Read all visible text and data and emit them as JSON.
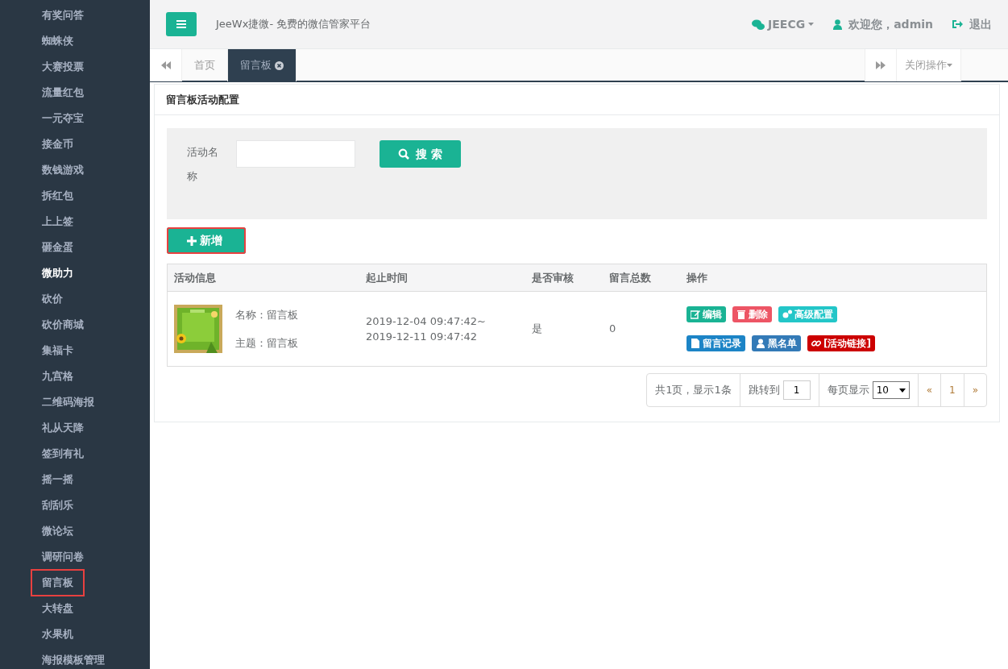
{
  "sidebar": {
    "items": [
      {
        "label": "有奖问答",
        "selected": false,
        "annotated": false
      },
      {
        "label": "蜘蛛侠",
        "selected": false,
        "annotated": false
      },
      {
        "label": "大赛投票",
        "selected": false,
        "annotated": false
      },
      {
        "label": "流量红包",
        "selected": false,
        "annotated": false
      },
      {
        "label": "一元夺宝",
        "selected": false,
        "annotated": false
      },
      {
        "label": "接金币",
        "selected": false,
        "annotated": false
      },
      {
        "label": "数钱游戏",
        "selected": false,
        "annotated": false
      },
      {
        "label": "拆红包",
        "selected": false,
        "annotated": false
      },
      {
        "label": "上上签",
        "selected": false,
        "annotated": false
      },
      {
        "label": "砸金蛋",
        "selected": false,
        "annotated": false
      },
      {
        "label": "微助力",
        "selected": true,
        "annotated": false
      },
      {
        "label": "砍价",
        "selected": false,
        "annotated": false
      },
      {
        "label": "砍价商城",
        "selected": false,
        "annotated": false
      },
      {
        "label": "集福卡",
        "selected": false,
        "annotated": false
      },
      {
        "label": "九宫格",
        "selected": false,
        "annotated": false
      },
      {
        "label": "二维码海报",
        "selected": false,
        "annotated": false
      },
      {
        "label": "礼从天降",
        "selected": false,
        "annotated": false
      },
      {
        "label": "签到有礼",
        "selected": false,
        "annotated": false
      },
      {
        "label": "摇一摇",
        "selected": false,
        "annotated": false
      },
      {
        "label": "刮刮乐",
        "selected": false,
        "annotated": false
      },
      {
        "label": "微论坛",
        "selected": false,
        "annotated": false
      },
      {
        "label": "调研问卷",
        "selected": false,
        "annotated": false
      },
      {
        "label": "留言板",
        "selected": false,
        "annotated": true
      },
      {
        "label": "大转盘",
        "selected": false,
        "annotated": false
      },
      {
        "label": "水果机",
        "selected": false,
        "annotated": false
      },
      {
        "label": "海报模板管理",
        "selected": false,
        "annotated": false
      }
    ]
  },
  "header": {
    "title": "JeeWx捷微- 免费的微信管家平台",
    "account_menu": "JEECG",
    "welcome": "欢迎您，admin",
    "logout": "退出"
  },
  "tabs": [
    {
      "label": "首页",
      "selected": false,
      "closable": false
    },
    {
      "label": "留言板",
      "selected": true,
      "closable": true
    }
  ],
  "close_menu": "关闭操作",
  "panel": {
    "title": "留言板活动配置",
    "search": {
      "label": "活动名称",
      "button": "搜 索"
    },
    "add_button": {
      "label": "新增",
      "annotated": true
    },
    "table": {
      "columns": [
        "活动信息",
        "起止时间",
        "是否审核",
        "留言总数",
        "操作"
      ],
      "rows": [
        {
          "name": "名称：留言板",
          "theme": "主题：留言板",
          "start": "2019-12-04 09:47:42~",
          "end": "2019-12-11 09:47:42",
          "audit": "是",
          "count": "0",
          "actions": [
            {
              "label": "编辑",
              "kind": "edit",
              "color": "#1ab394"
            },
            {
              "label": "删除",
              "kind": "delete",
              "color": "#ed5565"
            },
            {
              "label": "高级配置",
              "kind": "config",
              "color": "#23c6c8"
            },
            {
              "label": "留言记录",
              "kind": "record",
              "color": "#1c84c6"
            },
            {
              "label": "黑名单",
              "kind": "user",
              "color": "#337ab7"
            },
            {
              "label": "[活动链接]",
              "kind": "link",
              "color": "#cc0000"
            }
          ]
        }
      ]
    },
    "pagination": {
      "summary": "共1页，显示1条",
      "jump_label": "跳转到",
      "jump_value": "1",
      "per_page_label": "每页显示",
      "per_page": "10",
      "prev": "«",
      "pages": [
        {
          "label": "1",
          "selected": false
        }
      ],
      "next": "»"
    }
  }
}
